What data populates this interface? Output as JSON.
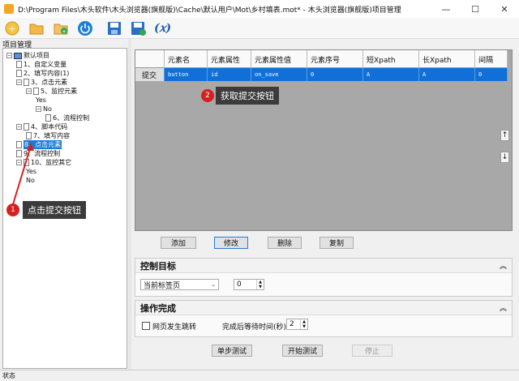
{
  "window": {
    "title": "D:\\Program Files\\木头软件\\木头浏览器(旗舰版)\\Cache\\默认用户\\Mot\\乡村填表.mot* - 木头浏览器(旗舰版)项目管理",
    "minimize": "—",
    "maximize": "☐",
    "close": "✕"
  },
  "toolbar": {
    "buttons": [
      "new-project-icon",
      "open-folder-icon",
      "add-icon",
      "power-icon",
      "save-icon",
      "save-as-icon",
      "variable-icon"
    ],
    "variable_label": "(𝑥)"
  },
  "sidebar": {
    "title": "项目管理",
    "tree": [
      {
        "label": "默认项目",
        "indent": 0,
        "icon": "pc",
        "expander": "−"
      },
      {
        "label": "1、自定义变量",
        "indent": 1,
        "icon": "doc"
      },
      {
        "label": "2、填写内容(1)",
        "indent": 1,
        "icon": "doc"
      },
      {
        "label": "3、点击元素",
        "indent": 1,
        "icon": "doc",
        "expander": "−"
      },
      {
        "label": "5、监控元素",
        "indent": 2,
        "icon": "doc",
        "expander": "−"
      },
      {
        "label": "Yes",
        "indent": 3,
        "icon": "none"
      },
      {
        "label": "No",
        "indent": 3,
        "icon": "none",
        "expander": "−"
      },
      {
        "label": "6、流程控制",
        "indent": 4,
        "icon": "doc"
      },
      {
        "label": "4、脚本代码",
        "indent": 1,
        "icon": "doc",
        "expander": "−"
      },
      {
        "label": "7、填写内容",
        "indent": 2,
        "icon": "doc"
      },
      {
        "label": "8、点击元素",
        "indent": 1,
        "icon": "doc",
        "selected": true
      },
      {
        "label": "9、流程控制",
        "indent": 1,
        "icon": "doc"
      },
      {
        "label": "10、监控其它",
        "indent": 1,
        "icon": "doc",
        "expander": "−"
      },
      {
        "label": "Yes",
        "indent": 2,
        "icon": "none"
      },
      {
        "label": "No",
        "indent": 2,
        "icon": "none"
      }
    ]
  },
  "grid": {
    "columns": [
      "元素名",
      "元素属性",
      "元素属性值",
      "元素序号",
      "短Xpath",
      "长Xpath",
      "间隔"
    ],
    "row_header": "提交",
    "row": [
      "button",
      "id",
      "on_save",
      "0",
      "A",
      "A",
      "0"
    ],
    "up_arrow": "↑",
    "down_arrow": "↓"
  },
  "buttons": {
    "add": "添加",
    "edit": "修改",
    "delete": "删除",
    "copy": "复制"
  },
  "control_target": {
    "title": "控制目标",
    "collapse": "︽",
    "tab_select": "当前标签页",
    "index_value": "0"
  },
  "action_complete": {
    "title": "操作完成",
    "collapse": "︽",
    "page_jump_label": "网页发生跳转",
    "wait_label": "完成后等待时间(秒)",
    "wait_value": "2"
  },
  "footer_buttons": {
    "step_test": "单步测试",
    "start_test": "开始测试",
    "stop": "停止"
  },
  "status": "状态",
  "annotations": {
    "badge1": "1",
    "callout1": "点击提交按钮",
    "badge2": "2",
    "callout2": "获取提交按钮"
  },
  "colors": {
    "selection": "#1170d8",
    "callout_bg": "#3b3b3b",
    "badge": "#d62020"
  }
}
